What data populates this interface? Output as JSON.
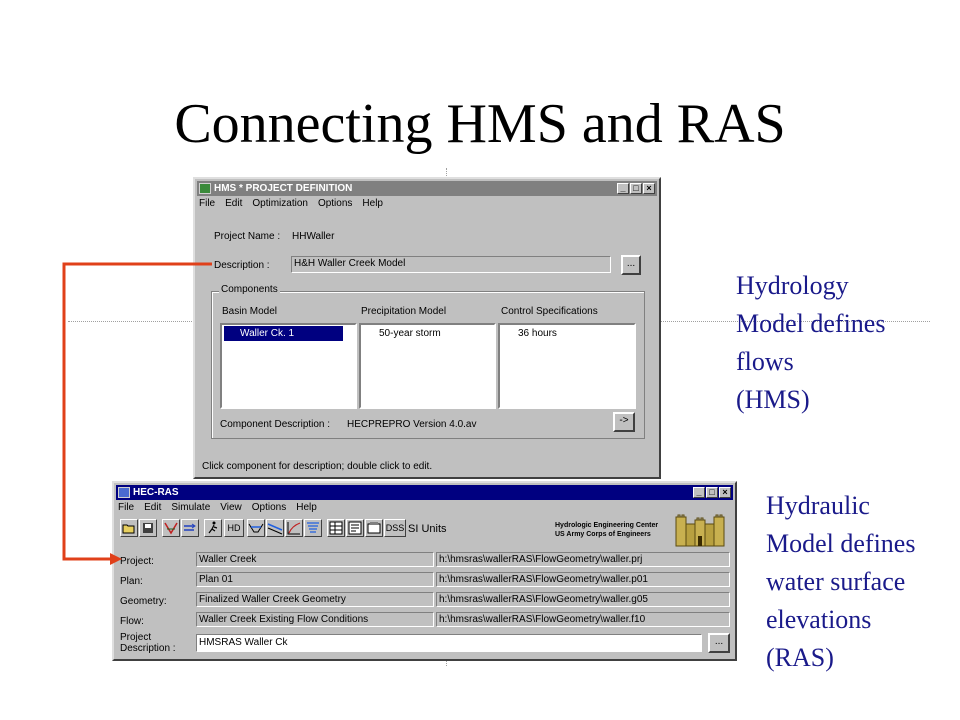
{
  "slide": {
    "title": "Connecting HMS and RAS",
    "hydrology_note": [
      "Hydrology",
      "Model defines",
      "flows",
      "(HMS)"
    ],
    "hydraulic_note": [
      "Hydraulic",
      "Model defines",
      "water surface",
      "elevations",
      "(RAS)"
    ]
  },
  "colors": {
    "connector": "#e0401a",
    "note_text": "#1a1a8a",
    "active_title": "#000080",
    "inactive_title": "#808080"
  },
  "hms": {
    "title": "HMS * PROJECT DEFINITION",
    "menu": [
      "File",
      "Edit",
      "Optimization",
      "Options",
      "Help"
    ],
    "project_name_label": "Project Name :",
    "project_name": "HHWaller",
    "description_label": "Description :",
    "description": "H&H Waller Creek Model",
    "browse_label": "...",
    "components_label": "Components",
    "basin_label": "Basin Model",
    "precip_label": "Precipitation Model",
    "control_label": "Control Specifications",
    "basin_item": "Waller Ck. 1",
    "precip_item": "50-year storm",
    "control_item": "36 hours",
    "component_desc_label": "Component Description :",
    "component_desc": "HECPREPRO Version 4.0.av",
    "arrow_label": "->",
    "status": "Click component for description; double click to edit."
  },
  "ras": {
    "title": "HEC-RAS",
    "menu": [
      "File",
      "Edit",
      "Simulate",
      "View",
      "Options",
      "Help"
    ],
    "toolbar_icons": [
      "open-folder-icon",
      "save-icon",
      "geometry-icon",
      "steady-flow-icon",
      "run-icon",
      "hd-icon",
      "cross-section-icon",
      "profile-icon",
      "rating-curve-icon",
      "perspective-icon",
      "table-icon",
      "summary-icon",
      "report-icon",
      "dss-icon"
    ],
    "hd_label": "HD",
    "dss_label": "DSS",
    "units": "SI Units",
    "org_line1": "Hydrologic Engineering Center",
    "org_line2": "US Army Corps of Engineers",
    "rows": [
      {
        "label": "Project:",
        "value": "Waller Creek",
        "file": "h:\\hmsras\\wallerRAS\\FlowGeometry\\waller.prj"
      },
      {
        "label": "Plan:",
        "value": "Plan 01",
        "file": "h:\\hmsras\\wallerRAS\\FlowGeometry\\waller.p01"
      },
      {
        "label": "Geometry:",
        "value": "Finalized Waller Creek Geometry",
        "file": "h:\\hmsras\\wallerRAS\\FlowGeometry\\waller.g05"
      },
      {
        "label": "Flow:",
        "value": "Waller Creek Existing Flow Conditions",
        "file": "h:\\hmsras\\wallerRAS\\FlowGeometry\\waller.f10"
      }
    ],
    "project_desc_label_1": "Project",
    "project_desc_label_2": "Description :",
    "project_desc": "HMSRAS Waller Ck",
    "browse_label": "..."
  }
}
